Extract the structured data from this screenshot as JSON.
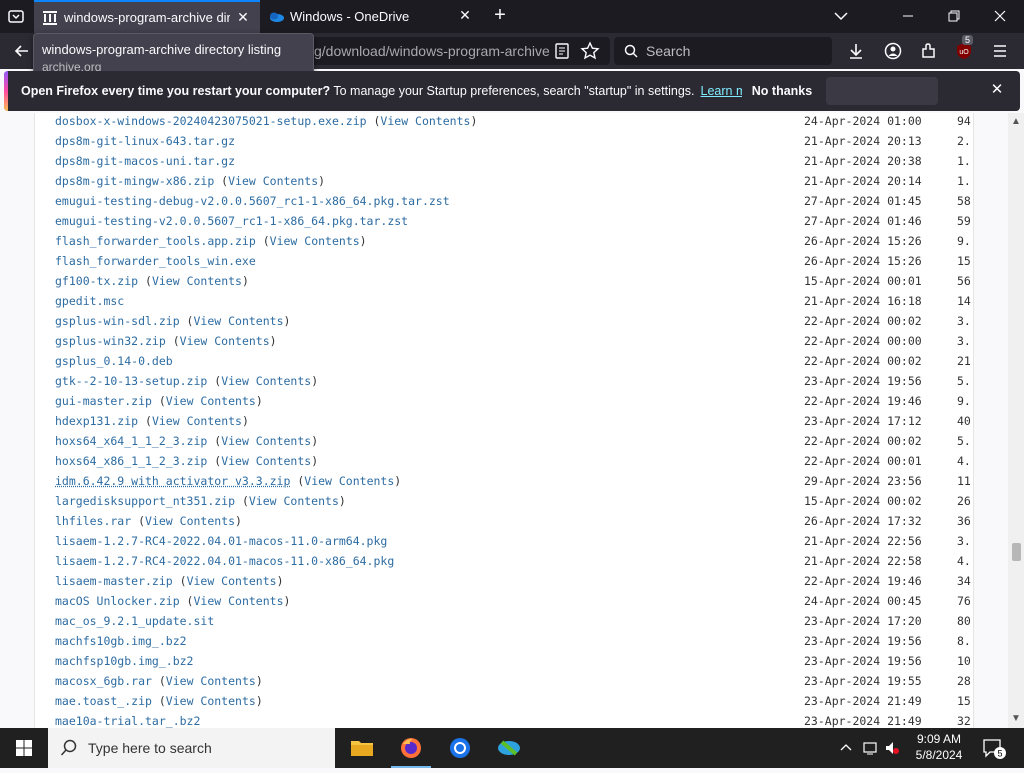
{
  "browser": {
    "tabs": [
      {
        "title": "windows-program-archive directory listing",
        "active": true
      },
      {
        "title": "Windows - OneDrive",
        "active": false
      }
    ],
    "url_visible": "g/download/windows-program-archive",
    "search_placeholder": "Search",
    "extension_badge": "5",
    "tooltip": {
      "title": "windows-program-archive directory listing",
      "domain": "archive.org"
    }
  },
  "notification": {
    "bold": "Open Firefox every time you restart your computer?",
    "text": " To manage your Startup preferences, search \"startup\" in settings.",
    "learn_more": "Learn more",
    "no_thanks": "No thanks"
  },
  "listing": {
    "view_contents_label": "View Contents",
    "rows": [
      {
        "name": "dosbox-x-windows-20240423075021-setup.exe.zip",
        "vc": true,
        "date": "24-Apr-2024 01:00",
        "size": "94"
      },
      {
        "name": "dps8m-git-linux-643.tar.gz",
        "vc": false,
        "date": "21-Apr-2024 20:13",
        "size": "2."
      },
      {
        "name": "dps8m-git-macos-uni.tar.gz",
        "vc": false,
        "date": "21-Apr-2024 20:38",
        "size": "1."
      },
      {
        "name": "dps8m-git-mingw-x86.zip",
        "vc": true,
        "date": "21-Apr-2024 20:14",
        "size": "1."
      },
      {
        "name": "emugui-testing-debug-v2.0.0.5607_rc1-1-x86_64.pkg.tar.zst",
        "vc": false,
        "date": "27-Apr-2024 01:45",
        "size": "58"
      },
      {
        "name": "emugui-testing-v2.0.0.5607_rc1-1-x86_64.pkg.tar.zst",
        "vc": false,
        "date": "27-Apr-2024 01:46",
        "size": "59"
      },
      {
        "name": "flash_forwarder_tools.app.zip",
        "vc": true,
        "date": "26-Apr-2024 15:26",
        "size": "9."
      },
      {
        "name": "flash_forwarder_tools_win.exe",
        "vc": false,
        "date": "26-Apr-2024 15:26",
        "size": "15"
      },
      {
        "name": "gf100-tx.zip",
        "vc": true,
        "date": "15-Apr-2024 00:01",
        "size": "56"
      },
      {
        "name": "gpedit.msc",
        "vc": false,
        "date": "21-Apr-2024 16:18",
        "size": "14"
      },
      {
        "name": "gsplus-win-sdl.zip",
        "vc": true,
        "date": "22-Apr-2024 00:02",
        "size": "3."
      },
      {
        "name": "gsplus-win32.zip",
        "vc": true,
        "date": "22-Apr-2024 00:00",
        "size": "3."
      },
      {
        "name": "gsplus_0.14-0.deb",
        "vc": false,
        "date": "22-Apr-2024 00:02",
        "size": "21"
      },
      {
        "name": "gtk--2-10-13-setup.zip",
        "vc": true,
        "date": "23-Apr-2024 19:56",
        "size": "5."
      },
      {
        "name": "gui-master.zip",
        "vc": true,
        "date": "22-Apr-2024 19:46",
        "size": "9."
      },
      {
        "name": "hdexp131.zip",
        "vc": true,
        "date": "23-Apr-2024 17:12",
        "size": "40"
      },
      {
        "name": "hoxs64_x64_1_1_2_3.zip",
        "vc": true,
        "date": "22-Apr-2024 00:02",
        "size": "5."
      },
      {
        "name": "hoxs64_x86_1_1_2_3.zip",
        "vc": true,
        "date": "22-Apr-2024 00:01",
        "size": "4."
      },
      {
        "name": "idm.6.42.9 with activator v3.3.zip",
        "vc": true,
        "date": "29-Apr-2024 23:56",
        "size": "11",
        "hover": true
      },
      {
        "name": "largedisksupport_nt351.zip",
        "vc": true,
        "date": "15-Apr-2024 00:02",
        "size": "26"
      },
      {
        "name": "lhfiles.rar",
        "vc": true,
        "date": "26-Apr-2024 17:32",
        "size": "36"
      },
      {
        "name": "lisaem-1.2.7-RC4-2022.04.01-macos-11.0-arm64.pkg",
        "vc": false,
        "date": "21-Apr-2024 22:56",
        "size": "3."
      },
      {
        "name": "lisaem-1.2.7-RC4-2022.04.01-macos-11.0-x86_64.pkg",
        "vc": false,
        "date": "21-Apr-2024 22:58",
        "size": "4."
      },
      {
        "name": "lisaem-master.zip",
        "vc": true,
        "date": "22-Apr-2024 19:46",
        "size": "34"
      },
      {
        "name": "macOS Unlocker.zip",
        "vc": true,
        "date": "24-Apr-2024 00:45",
        "size": "76"
      },
      {
        "name": "mac_os_9.2.1_update.sit",
        "vc": false,
        "date": "23-Apr-2024 17:20",
        "size": "80"
      },
      {
        "name": "machfs10gb.img_.bz2",
        "vc": false,
        "date": "23-Apr-2024 19:56",
        "size": "8."
      },
      {
        "name": "machfsp10gb.img_.bz2",
        "vc": false,
        "date": "23-Apr-2024 19:56",
        "size": "10"
      },
      {
        "name": "macosx_6gb.rar",
        "vc": true,
        "date": "23-Apr-2024 19:55",
        "size": "28"
      },
      {
        "name": "mae.toast_.zip",
        "vc": true,
        "date": "23-Apr-2024 21:49",
        "size": "15"
      },
      {
        "name": "mae10a-trial.tar_.bz2",
        "vc": false,
        "date": "23-Apr-2024 21:49",
        "size": "32"
      }
    ]
  },
  "taskbar": {
    "search_placeholder": "Type here to search",
    "time": "9:09 AM",
    "date": "5/8/2024",
    "notification_count": "5"
  }
}
